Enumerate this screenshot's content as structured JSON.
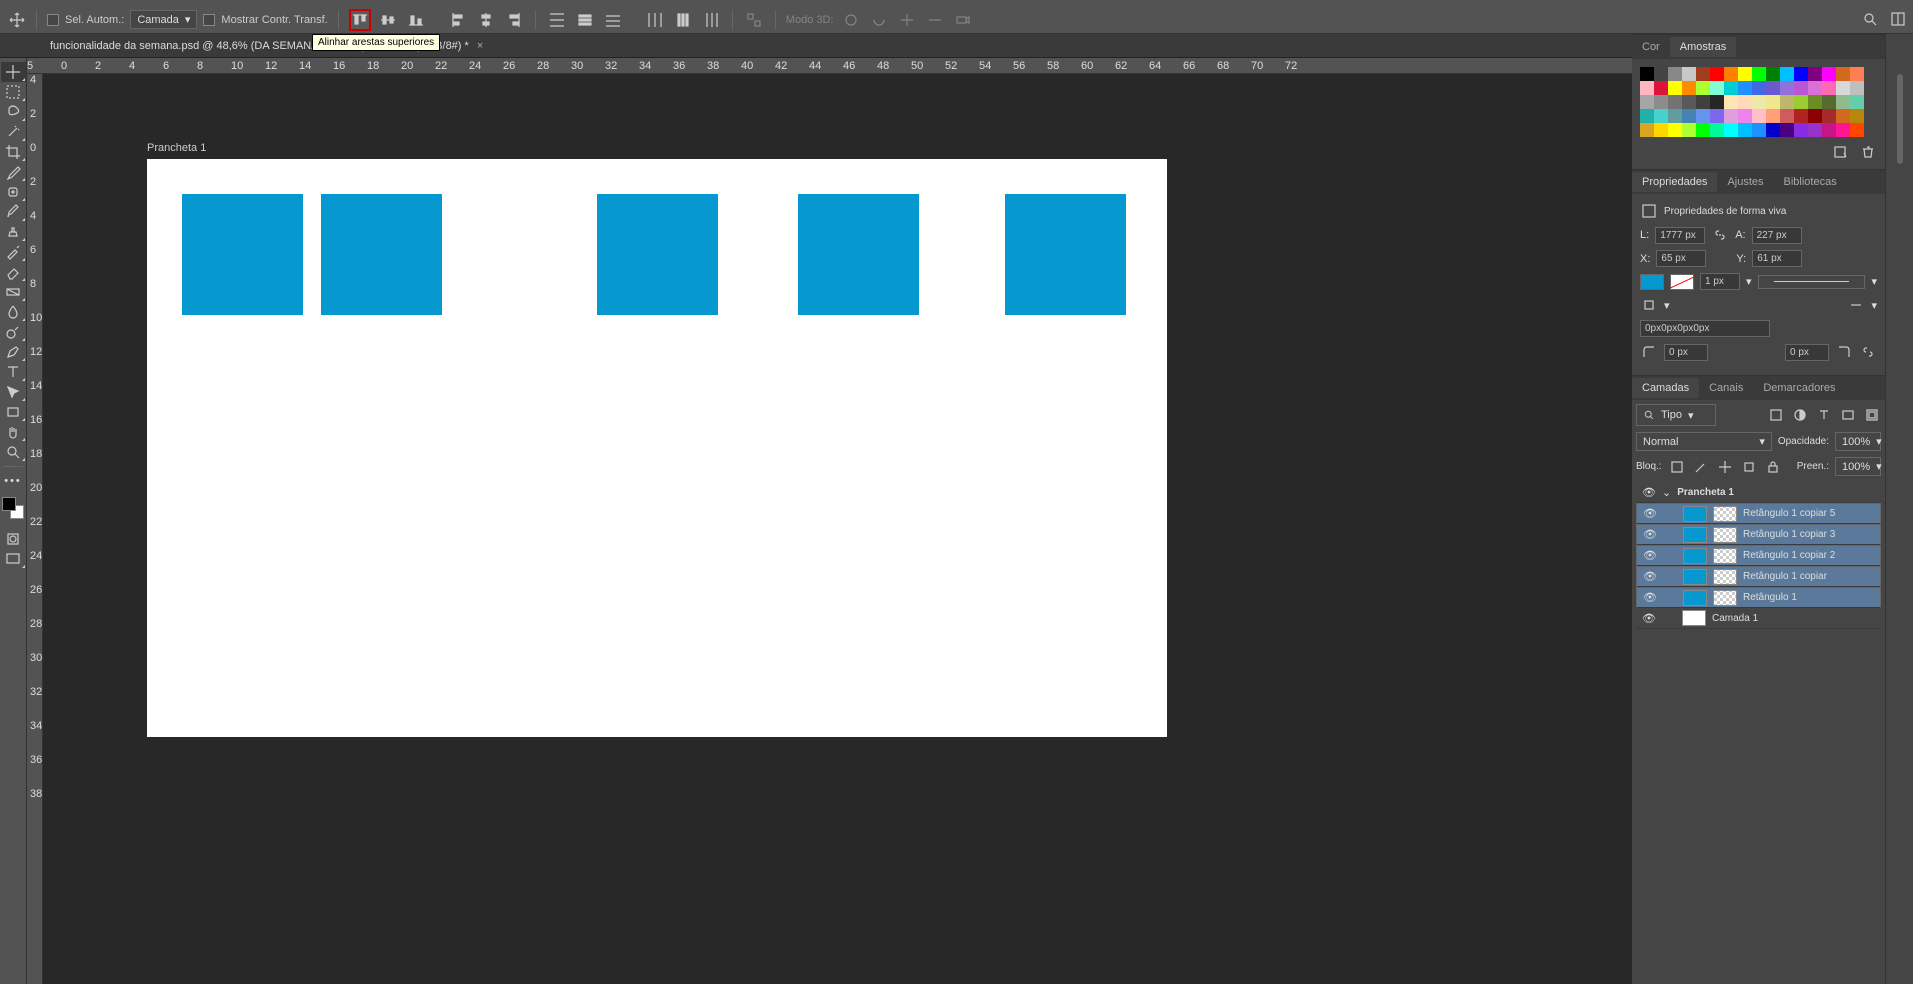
{
  "optionsBar": {
    "selAuto": "Sel. Autom.:",
    "layerDropdown": "Camada",
    "showTransform": "Mostrar Contr. Transf.",
    "mode3d": "Modo 3D:"
  },
  "tooltip": "Alinhar arestas superiores",
  "tabs": {
    "tab1": "funcionalidade da semana.psd @ 48,6% (DA SEMANA, RGB/8*) *",
    "tab2": ",7% (RGB/8#) *"
  },
  "artboard": {
    "label": "Prancheta 1"
  },
  "ruler": {
    "h": [
      "5",
      "0",
      "2",
      "4",
      "6",
      "8",
      "10",
      "12",
      "14",
      "16",
      "18",
      "20",
      "22",
      "24",
      "26",
      "28",
      "30",
      "32",
      "34",
      "36",
      "38",
      "40",
      "42",
      "44",
      "46",
      "48",
      "50",
      "52",
      "54",
      "56",
      "58",
      "60",
      "62",
      "64",
      "66",
      "68",
      "70",
      "72"
    ],
    "v": [
      "4",
      "2",
      "0",
      "2",
      "4",
      "6",
      "8",
      "10",
      "12",
      "14",
      "16",
      "18",
      "20",
      "22",
      "24",
      "26",
      "28",
      "30",
      "32",
      "34",
      "36",
      "38"
    ]
  },
  "panelTabs": {
    "cor": "Cor",
    "amostras": "Amostras",
    "propriedades": "Propriedades",
    "ajustes": "Ajustes",
    "bibliotecas": "Bibliotecas",
    "camadas": "Camadas",
    "canais": "Canais",
    "demarcadores": "Demarcadores"
  },
  "properties": {
    "title": "Propriedades de forma viva",
    "L": "L:",
    "Lval": "1777 px",
    "A": "A:",
    "Aval": "227 px",
    "X": "X:",
    "Xval": "65 px",
    "Y": "Y:",
    "Yval": "61 px",
    "stroke": "1 px",
    "corner": "0px0px0px0px",
    "c1": "0 px",
    "c2": "0 px"
  },
  "layersPanel": {
    "filter": "Tipo",
    "blend": "Normal",
    "opacLabel": "Opacidade:",
    "opac": "100%",
    "lockLabel": "Bloq.:",
    "fillLabel": "Preen.:",
    "fill": "100%",
    "artboard": "Prancheta 1",
    "layers": [
      "Retângulo 1 copiar 5",
      "Retângulo 1 copiar 3",
      "Retângulo 1 copiar 2",
      "Retângulo 1 copiar",
      "Retângulo 1",
      "Camada 1"
    ]
  },
  "swatches": [
    "#000",
    "#444",
    "#888",
    "#c8c8c8",
    "#a13c1f",
    "#ff0000",
    "#ff8000",
    "#ffff00",
    "#00ff00",
    "#008000",
    "#00c0ff",
    "#0000ff",
    "#800080",
    "#ff00ff",
    "#d2691e",
    "#ff7f50",
    "#ffb6c1",
    "#dc143c",
    "#ff0",
    "#ff8c00",
    "#adff2f",
    "#7fffd4",
    "#00ced1",
    "#1e90ff",
    "#4169e1",
    "#6a5acd",
    "#9370db",
    "#ba55d3",
    "#da70d6",
    "#ff69b4",
    "#d8d8d8",
    "#bfbfbf",
    "#a6a6a6",
    "#8c8c8c",
    "#737373",
    "#595959",
    "#404040",
    "#262626",
    "#ffe4b5",
    "#ffdab9",
    "#eee8aa",
    "#f0e68c",
    "#bdb76b",
    "#9acd32",
    "#6b8e23",
    "#556b2f",
    "#8fbc8f",
    "#66cdaa",
    "#20b2aa",
    "#48d1cc",
    "#5f9ea0",
    "#4682b4",
    "#6495ed",
    "#7b68ee",
    "#dda0dd",
    "#ee82ee",
    "#ffc0cb",
    "#ffa07a",
    "#cd5c5c",
    "#b22222",
    "#8b0000",
    "#a52a2a",
    "#d2691e",
    "#b8860b",
    "#daa520",
    "#ffd700",
    "#ffff00",
    "#adff2f",
    "#00ff00",
    "#00fa9a",
    "#00ffff",
    "#00bfff",
    "#1e90ff",
    "#0000cd",
    "#4b0082",
    "#8a2be2",
    "#9932cc",
    "#c71585",
    "#ff1493",
    "#ff4500"
  ]
}
